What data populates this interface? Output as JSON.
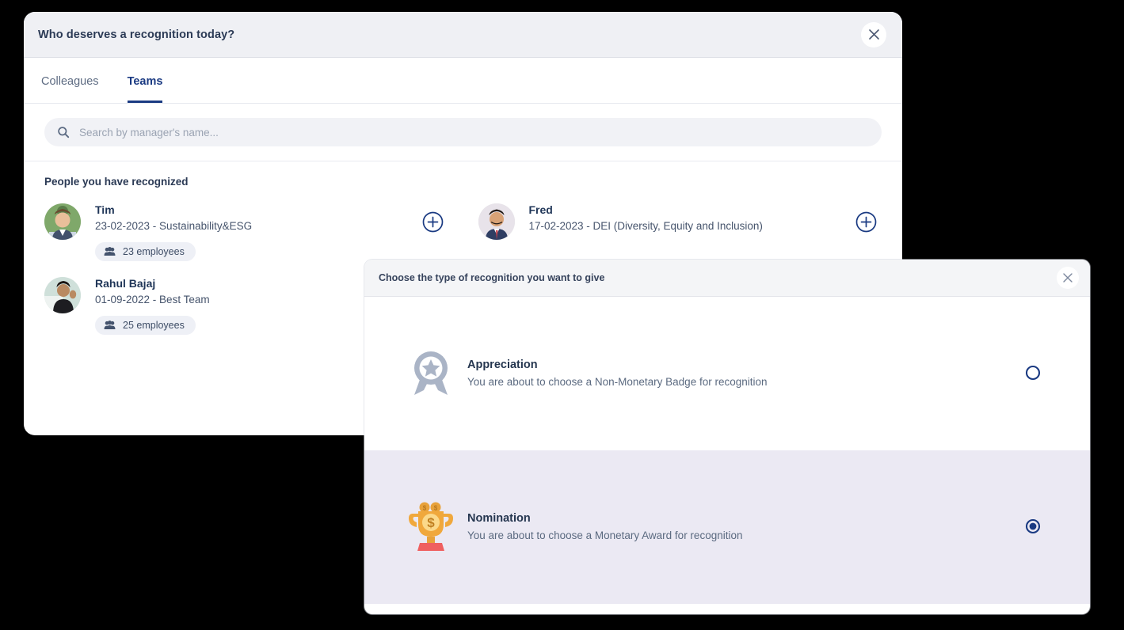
{
  "colors": {
    "navy": "#1a3a82",
    "header_bg": "#eff0f4",
    "selected_row_bg": "#ebe9f3",
    "chip_bg": "#eef0f6",
    "trophy_gold": "#f0a83c",
    "trophy_base_red": "#ef5f5f",
    "badge_gray": "#aab4c6"
  },
  "people_modal": {
    "title": "Who deserves a recognition today?",
    "close_icon": "close-icon",
    "tabs": [
      {
        "label": "Colleagues",
        "active": false
      },
      {
        "label": "Teams",
        "active": true
      }
    ],
    "search": {
      "icon": "search-icon",
      "placeholder": "Search by manager's name...",
      "value": ""
    },
    "section_label": "People you have recognized",
    "people": [
      {
        "name": "Tim",
        "detail": "23-02-2023 - Sustainability&ESG",
        "employees": "23 employees",
        "chip_icon": "people-group-icon",
        "add_icon": "plus-circle-icon",
        "avatar": "photo-avatar-tim"
      },
      {
        "name": "Fred",
        "detail": "17-02-2023 - DEI (Diversity, Equity and Inclusion)",
        "employees": "",
        "chip_icon": "people-group-icon",
        "add_icon": "plus-circle-icon",
        "avatar": "photo-avatar-fred"
      },
      {
        "name": "Rahul Bajaj",
        "detail": "01-09-2022 - Best Team",
        "employees": "25 employees",
        "chip_icon": "people-group-icon",
        "add_icon": "plus-circle-icon",
        "avatar": "photo-avatar-rahul"
      }
    ]
  },
  "type_modal": {
    "title": "Choose the type of recognition you want to give",
    "close_icon": "close-icon",
    "options": [
      {
        "title": "Appreciation",
        "desc": "You are about to choose a Non-Monetary Badge for recognition",
        "icon": "award-badge-icon",
        "selected": false
      },
      {
        "title": "Nomination",
        "desc": "You are about to choose a Monetary Award for recognition",
        "icon": "trophy-money-icon",
        "selected": true
      }
    ]
  }
}
